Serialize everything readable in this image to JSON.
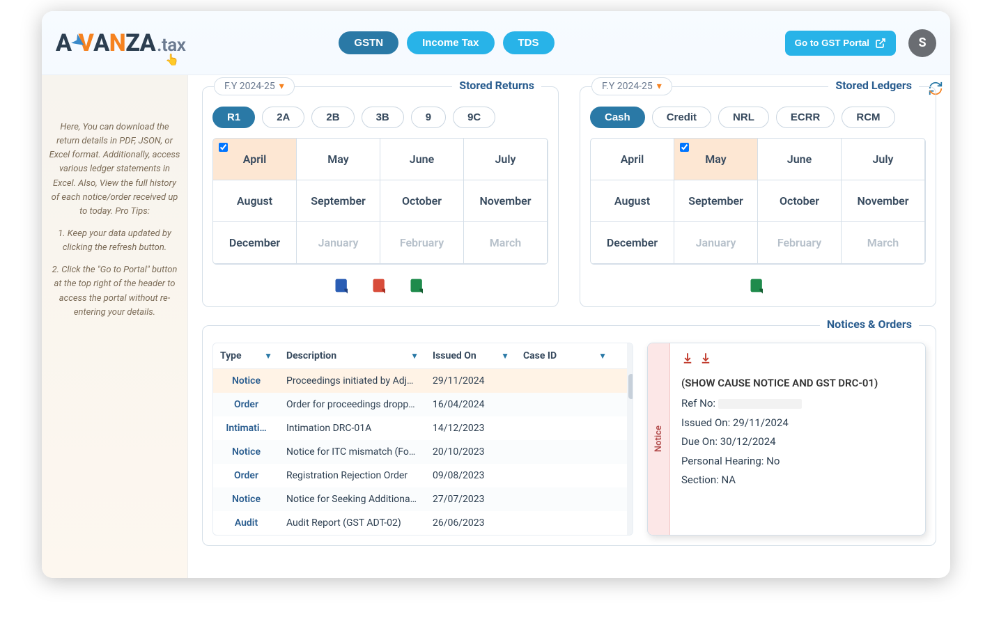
{
  "header": {
    "logo_text": "AVANZA",
    "logo_suffix": ".tax",
    "tabs": {
      "gstn": "GSTN",
      "income_tax": "Income Tax",
      "tds": "TDS"
    },
    "go_portal": "Go to GST Portal",
    "avatar_initial": "S"
  },
  "sidebar": {
    "p1": "Here, You can download the return details in PDF, JSON, or Excel format. Additionally, access various ledger statements in Excel. Also, View the full history of each notice/order received up to today. Pro Tips:",
    "p2": "1. Keep your data updated by clicking the refresh button.",
    "p3": "2. Click the \"Go to Portal\" button at the top right of the header to access the portal without re-entering your details."
  },
  "returns_panel": {
    "title": "Stored Returns",
    "fy_label": "F.Y 2024-25",
    "chips": [
      "R1",
      "2A",
      "2B",
      "3B",
      "9",
      "9C"
    ],
    "months": [
      "April",
      "May",
      "June",
      "July",
      "August",
      "September",
      "October",
      "November",
      "December",
      "January",
      "February",
      "March"
    ],
    "selected_month": "April"
  },
  "ledgers_panel": {
    "title": "Stored Ledgers",
    "fy_label": "F.Y 2024-25",
    "chips": [
      "Cash",
      "Credit",
      "NRL",
      "ECRR",
      "RCM"
    ],
    "months": [
      "April",
      "May",
      "June",
      "July",
      "August",
      "September",
      "October",
      "November",
      "December",
      "January",
      "February",
      "March"
    ],
    "selected_month": "May"
  },
  "notices": {
    "title": "Notices & Orders",
    "columns": {
      "type": "Type",
      "desc": "Description",
      "issued": "Issued On",
      "caseid": "Case ID"
    },
    "rows": [
      {
        "type": "Notice",
        "desc": "Proceedings initiated by Adj…",
        "issued": "29/11/2024",
        "caseid": ""
      },
      {
        "type": "Order",
        "desc": "Order for proceedings dropp…",
        "issued": "16/04/2024",
        "caseid": ""
      },
      {
        "type": "Intimati…",
        "desc": "Intimation DRC-01A",
        "issued": "14/12/2023",
        "caseid": ""
      },
      {
        "type": "Notice",
        "desc": "Notice for ITC mismatch (Fo…",
        "issued": "20/10/2023",
        "caseid": ""
      },
      {
        "type": "Order",
        "desc": "Registration Rejection Order",
        "issued": "09/08/2023",
        "caseid": ""
      },
      {
        "type": "Notice",
        "desc": "Notice for Seeking Additiona…",
        "issued": "27/07/2023",
        "caseid": ""
      },
      {
        "type": "Audit",
        "desc": "Audit Report (GST ADT-02)",
        "issued": "26/06/2023",
        "caseid": ""
      }
    ],
    "detail": {
      "tab_label": "Notice",
      "heading": "(SHOW CAUSE NOTICE AND GST DRC-01)",
      "ref_label": "Ref No:",
      "issued_label": "Issued On: 29/11/2024",
      "due_label": "Due On: 30/12/2024",
      "hearing_label": "Personal Hearing: No",
      "section_label": "Section: NA"
    }
  }
}
